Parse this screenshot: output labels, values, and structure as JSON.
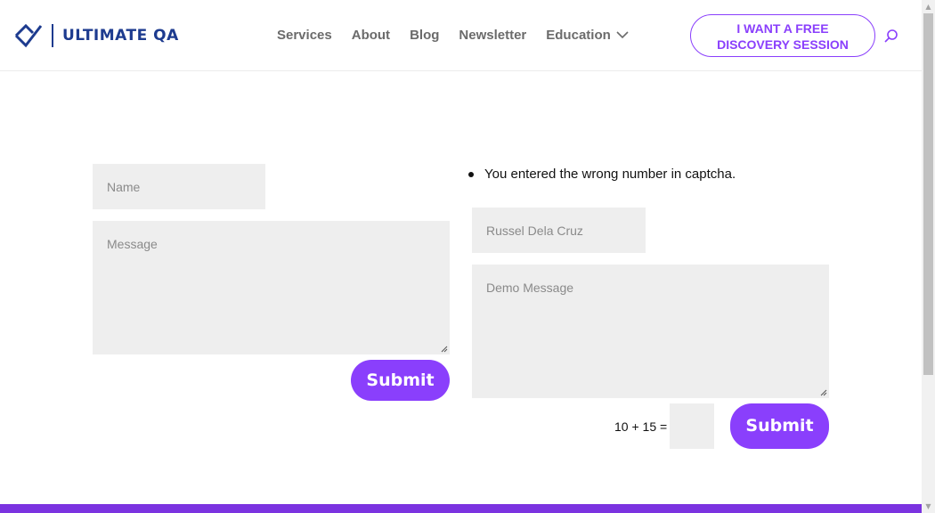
{
  "header": {
    "logo_text": "ULTIMATE QA",
    "nav": [
      {
        "label": "Services"
      },
      {
        "label": "About"
      },
      {
        "label": "Blog"
      },
      {
        "label": "Newsletter"
      },
      {
        "label": "Education"
      }
    ],
    "cta_line1": "I WANT A FREE",
    "cta_line2": "DISCOVERY SESSION"
  },
  "form_left": {
    "name_placeholder": "Name",
    "message_placeholder": "Message",
    "submit_label": "Submit"
  },
  "form_right": {
    "error_message": "You entered the wrong number in captcha.",
    "name_value": "Russel Dela Cruz",
    "message_value": "Demo Message",
    "captcha_question": "10 + 15 =",
    "captcha_value": "",
    "submit_label": "Submit"
  },
  "colors": {
    "brand": "#1d3b8f",
    "accent": "#8a3ffc",
    "field_bg": "#eeeeee",
    "footer": "#7b33e0"
  }
}
